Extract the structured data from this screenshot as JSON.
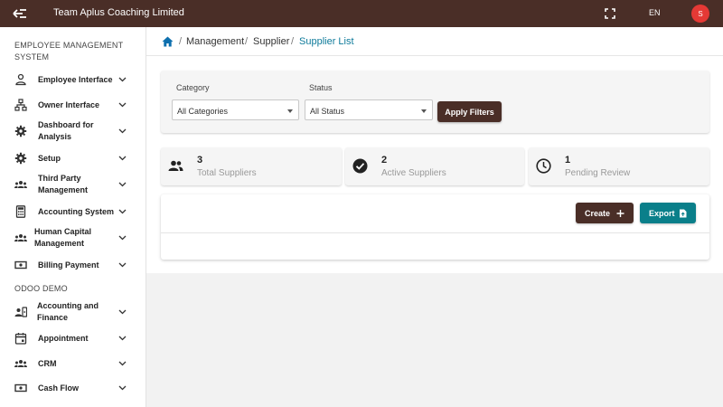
{
  "app": {
    "title": "Team Aplus Coaching Limited",
    "language": "EN",
    "avatar_initial": "S"
  },
  "sidebar": {
    "section1": "EMPLOYEE MANAGEMENT SYSTEM",
    "section2": "ODOO DEMO",
    "items": [
      {
        "label": "Employee Interface",
        "icon": "person-icon"
      },
      {
        "label": "Owner Interface",
        "icon": "hierarchy-icon"
      },
      {
        "label": "Dashboard for Analysis",
        "icon": "gear-icon"
      },
      {
        "label": "Setup",
        "icon": "gear-icon"
      },
      {
        "label": "Third Party Management",
        "icon": "group-icon"
      },
      {
        "label": "Accounting System",
        "icon": "calculator-icon"
      },
      {
        "label": "Human Capital Management",
        "icon": "group-icon"
      },
      {
        "label": "Billing Payment",
        "icon": "cash-icon"
      },
      {
        "label": "Accounting and Finance",
        "icon": "contact-icon"
      },
      {
        "label": "Appointment",
        "icon": "calendar-icon"
      },
      {
        "label": "CRM",
        "icon": "group-icon"
      },
      {
        "label": "Cash Flow",
        "icon": "cash-icon"
      }
    ]
  },
  "breadcrumb": {
    "items": [
      "Management",
      "Supplier",
      "Supplier List"
    ],
    "separator": "/"
  },
  "filters": {
    "category_label": "Category",
    "category_value": "All Categories",
    "status_label": "Status",
    "status_value": "All Status",
    "apply_label": "Apply Filters"
  },
  "stats": [
    {
      "value": "3",
      "label": "Total Suppliers",
      "icon": "people-icon"
    },
    {
      "value": "2",
      "label": "Active Suppliers",
      "icon": "check-circle-icon"
    },
    {
      "value": "1",
      "label": "Pending Review",
      "icon": "clock-icon"
    }
  ],
  "actions": {
    "create_label": "Create",
    "export_label": "Export"
  },
  "colors": {
    "brand": "#4a2e27",
    "accent": "#0a7f8a",
    "link": "#0d7a9a",
    "avatar": "#e53935"
  }
}
